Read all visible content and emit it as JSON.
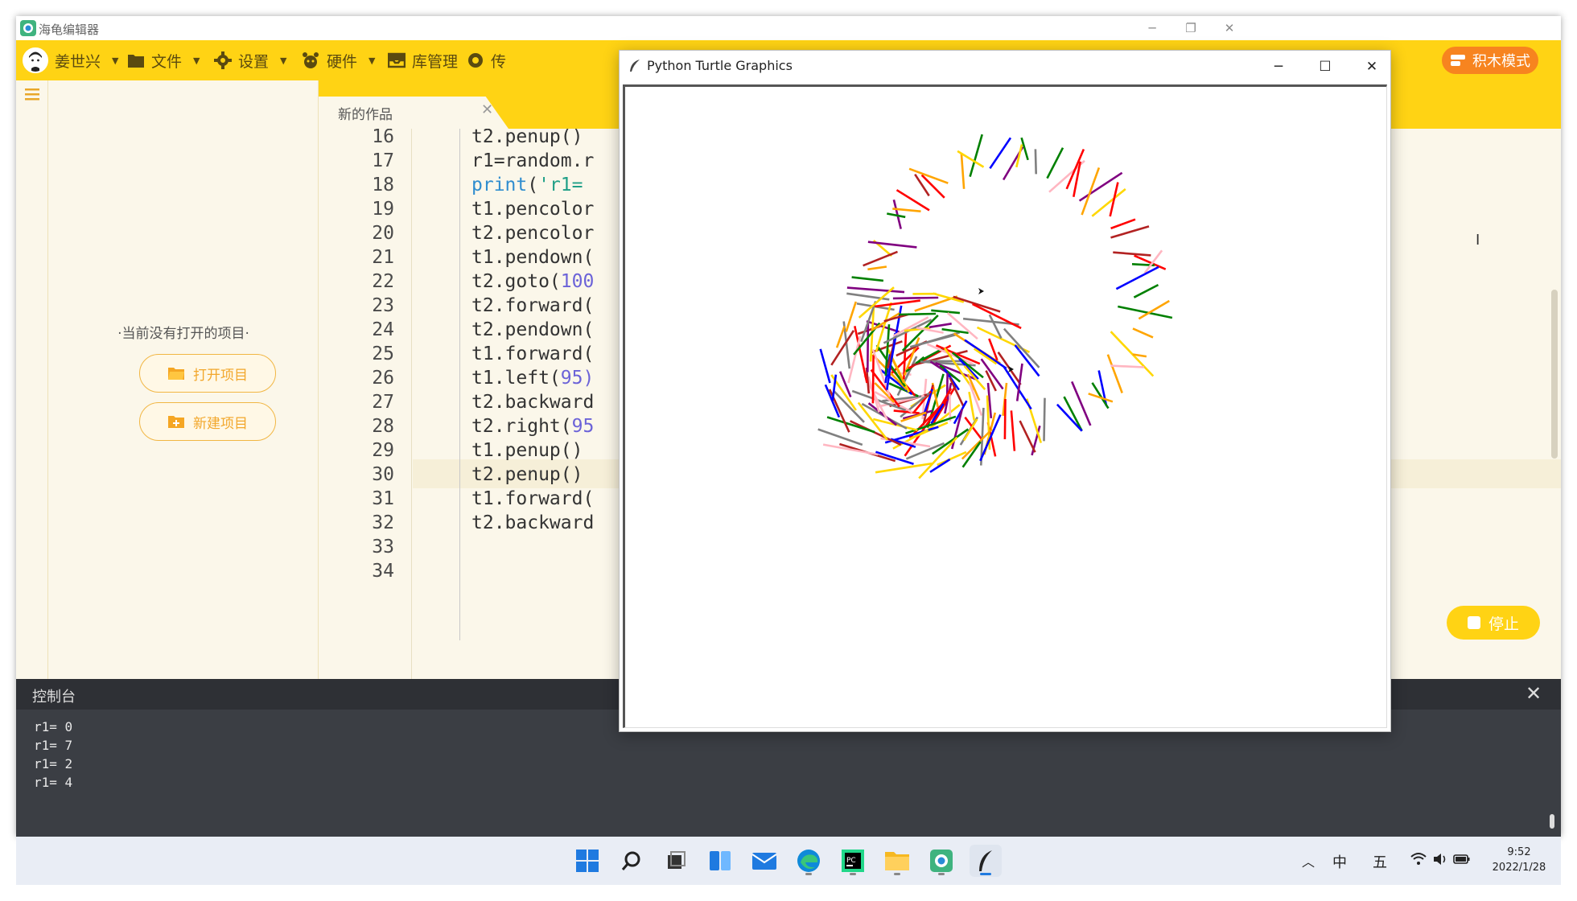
{
  "app": {
    "title": "海龟编辑器",
    "menu": {
      "user": "姜世兴",
      "file": "文件",
      "settings": "设置",
      "hardware": "硬件",
      "library": "库管理",
      "partial": "传",
      "block_mode": "积木模式"
    },
    "sidebar": {
      "no_project": "·当前没有打开的项目·",
      "open_project": "打开项目",
      "new_project": "新建项目"
    },
    "tab": {
      "label": "新的作品"
    },
    "editor": {
      "lines": [
        {
          "n": "16",
          "code": "t2.penup()"
        },
        {
          "n": "17",
          "code": "r1=random.r"
        },
        {
          "n": "18",
          "kw": "print",
          "rest": "(",
          "str": "'r1="
        },
        {
          "n": "19",
          "code": "t1.pencolor"
        },
        {
          "n": "20",
          "code": "t2.pencolor"
        },
        {
          "n": "21",
          "code": "t1.pendown("
        },
        {
          "n": "22",
          "code": "t2.goto(",
          "num": "100"
        },
        {
          "n": "23",
          "code": "t2.forward("
        },
        {
          "n": "24",
          "code": "t2.pendown("
        },
        {
          "n": "25",
          "code": "t1.forward("
        },
        {
          "n": "26",
          "code": "t1.left(",
          "num": "95)"
        },
        {
          "n": "27",
          "code": "t2.backward"
        },
        {
          "n": "28",
          "code": "t2.right(",
          "num": "95"
        },
        {
          "n": "29",
          "code": "t1.penup()"
        },
        {
          "n": "30",
          "code": "t2.penup()"
        },
        {
          "n": "31",
          "code": "t1.forward("
        },
        {
          "n": "32",
          "code": "t2.backward"
        },
        {
          "n": "33",
          "code": ""
        },
        {
          "n": "34",
          "code": ""
        }
      ],
      "stop": "停止"
    },
    "console": {
      "title": "控制台",
      "lines": [
        "r1= 0",
        "r1= 7",
        "r1= 2",
        "r1= 4"
      ]
    }
  },
  "turtle_window": {
    "title": "Python Turtle Graphics",
    "stroke_colors": [
      "#ff0000",
      "#ffd700",
      "#0000ff",
      "#008000",
      "#ffa500",
      "#800080",
      "#ffb6c1",
      "#808080",
      "#b22222"
    ]
  },
  "taskbar": {
    "icons": [
      "start-icon",
      "search-icon",
      "task-view-icon",
      "widgets-icon",
      "mail-icon",
      "edge-icon",
      "pycharm-icon",
      "file-explorer-icon",
      "turtle-editor-icon",
      "python-feather-icon"
    ],
    "tray": {
      "ime_lang": "中",
      "ime_mode": "五"
    },
    "time": "9:52",
    "date": "2022/1/28"
  }
}
